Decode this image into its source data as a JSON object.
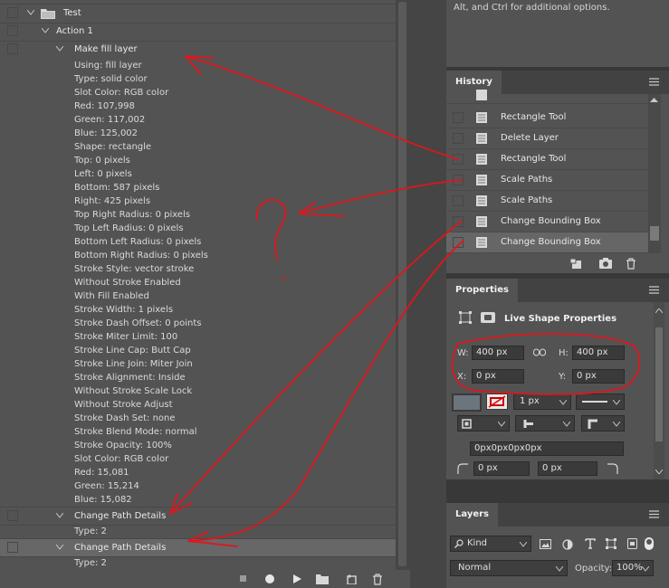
{
  "actions": {
    "set_name": "Test",
    "action_name": "Action 1",
    "step1_name": "Make fill layer",
    "step1_params": [
      "Using: fill layer",
      "Type: solid color",
      "Slot Color: RGB color",
      "Red: 107,998",
      "Green: 117,002",
      "Blue: 125,002",
      "Shape: rectangle",
      "Top: 0 pixels",
      "Left: 0 pixels",
      "Bottom: 587 pixels",
      "Right: 425 pixels",
      "Top Right Radius: 0 pixels",
      "Top Left Radius: 0 pixels",
      "Bottom Left Radius: 0 pixels",
      "Bottom Right Radius: 0 pixels",
      "Stroke Style: vector stroke",
      "Without Stroke Enabled",
      "With Fill Enabled",
      "Stroke Width: 1 pixels",
      "Stroke Dash Offset: 0 points",
      "Stroke Miter Limit: 100",
      "Stroke Line Cap: Butt Cap",
      "Stroke Line Join: Miter Join",
      "Stroke Alignment: Inside",
      "Without Stroke Scale Lock",
      "Without Stroke Adjust",
      "Stroke Dash Set: none",
      "Stroke Blend Mode: normal",
      "Stroke Opacity: 100%",
      "Slot Color: RGB color",
      "Red: 15,081",
      "Green: 15,214",
      "Blue: 15,082"
    ],
    "step2_name": "Change Path Details",
    "step2_param": "Type: 2",
    "step3_name": "Change Path Details",
    "step3_param": "Type: 2"
  },
  "hint": {
    "text": "Alt, and Ctrl for additional options."
  },
  "history": {
    "tab": "History",
    "items": [
      "Rectangle Tool",
      "Delete Layer",
      "Rectangle Tool",
      "Scale Paths",
      "Scale Paths",
      "Change Bounding Box",
      "Change Bounding Box"
    ]
  },
  "properties": {
    "tab": "Properties",
    "title": "Live Shape Properties",
    "w_label": "W:",
    "w_value": "400 px",
    "h_label": "H:",
    "h_value": "400 px",
    "x_label": "X:",
    "x_value": "0 px",
    "y_label": "Y:",
    "y_value": "0 px",
    "stroke_width": "1 px",
    "corner_text": "0px0px0px0px",
    "corner_left": "0 px",
    "corner_right": "0 px"
  },
  "layers": {
    "tab": "Layers",
    "kind_label": "Kind",
    "blend_mode": "Normal",
    "opacity_label": "Opacity:",
    "opacity_value": "100%"
  },
  "colors": {
    "annotation": "#e0151b",
    "panel": "#535353",
    "panel_dark": "#383838",
    "fill_swatch": "#6b757d"
  }
}
